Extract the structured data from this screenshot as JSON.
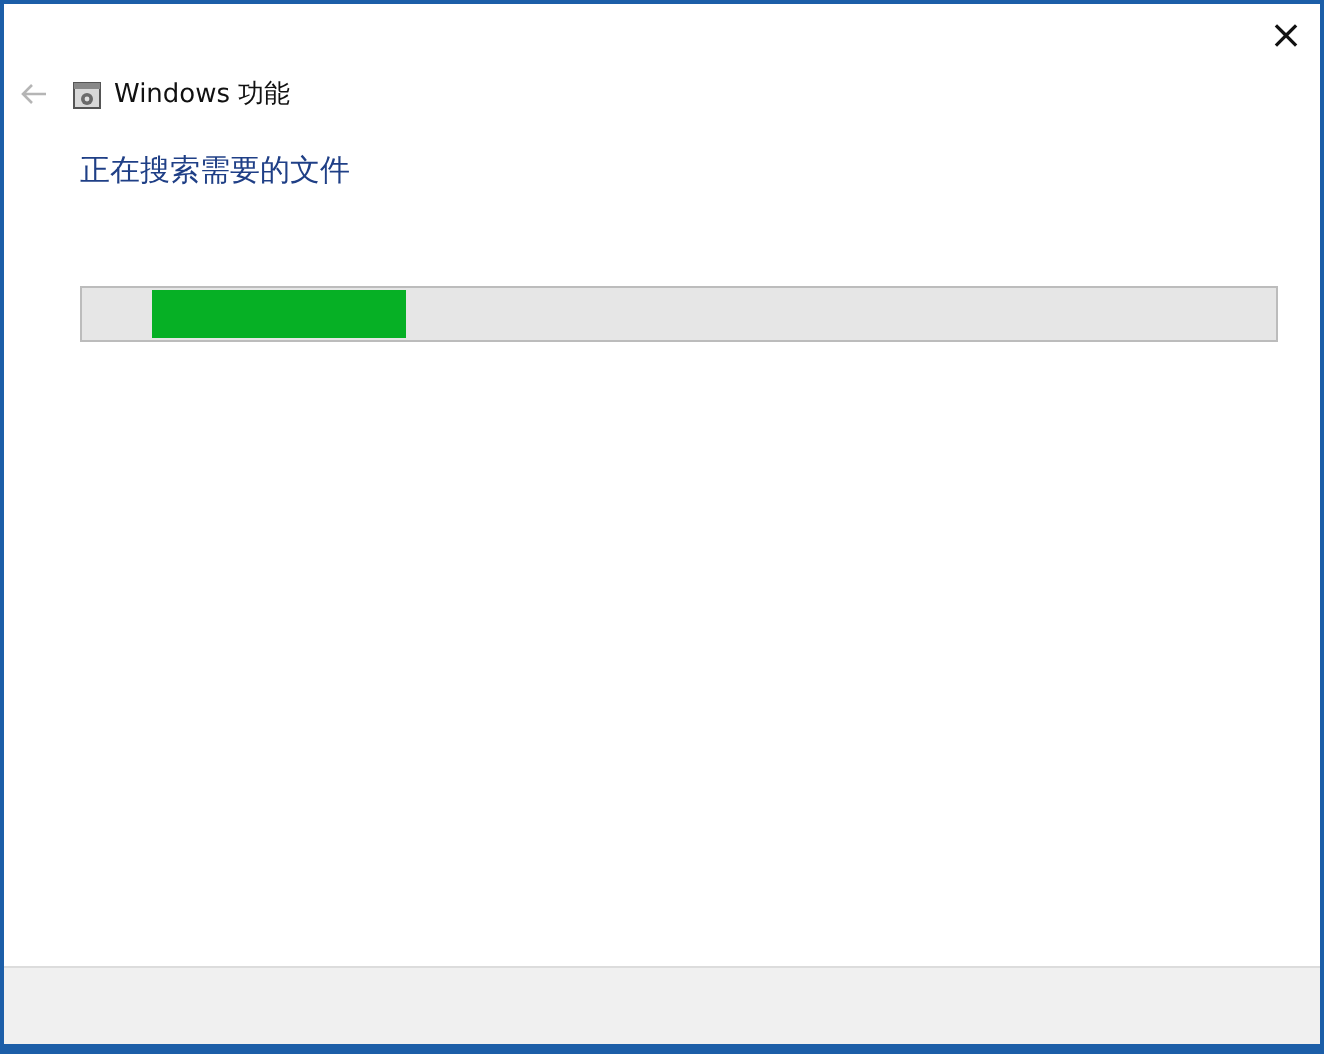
{
  "window": {
    "title": "Windows 功能",
    "close": "×"
  },
  "back": {
    "disabled": true
  },
  "heading": "正在搜索需要的文件",
  "progress": {
    "indeterminate": true
  }
}
